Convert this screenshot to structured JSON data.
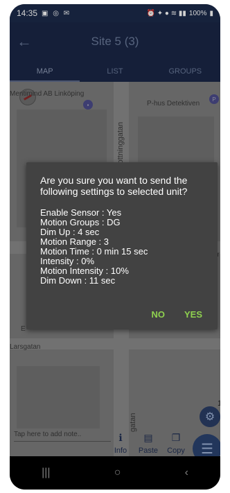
{
  "status_bar": {
    "time": "14:35",
    "battery": "100%"
  },
  "app_bar": {
    "title": "Site 5 (3)"
  },
  "tabs": [
    {
      "label": "MAP",
      "active": true
    },
    {
      "label": "LIST",
      "active": false
    },
    {
      "label": "GROUPS",
      "active": false
    }
  ],
  "map": {
    "labels": {
      "place_1": "Mentimind AB Linköping",
      "street_1": "Drottninggatan",
      "place_2": "P-hus Detektiven",
      "street_2": "Larsgatan",
      "street_3": "gatan",
      "partial_1": "akyr",
      "partial_2": "E"
    },
    "fab_badge": "1"
  },
  "note_input": {
    "placeholder": "Tap here to add note.."
  },
  "actions": {
    "info": "Info",
    "paste": "Paste",
    "copy": "Copy"
  },
  "dialog": {
    "question": "Are you sure you want to send the following settings to selected unit?",
    "settings": [
      "Enable Sensor : Yes",
      "Motion Groups : DG",
      "Dim Up : 4 sec",
      "Motion Range : 3",
      "Motion Time : 0 min 15 sec",
      "Intensity : 0%",
      "Motion Intensity : 10%",
      "Dim Down : 11 sec"
    ],
    "no_label": "NO",
    "yes_label": "YES"
  },
  "colors": {
    "app_bar": "#1a2746",
    "dialog_bg": "#424242",
    "dialog_button": "#8fd14f"
  }
}
